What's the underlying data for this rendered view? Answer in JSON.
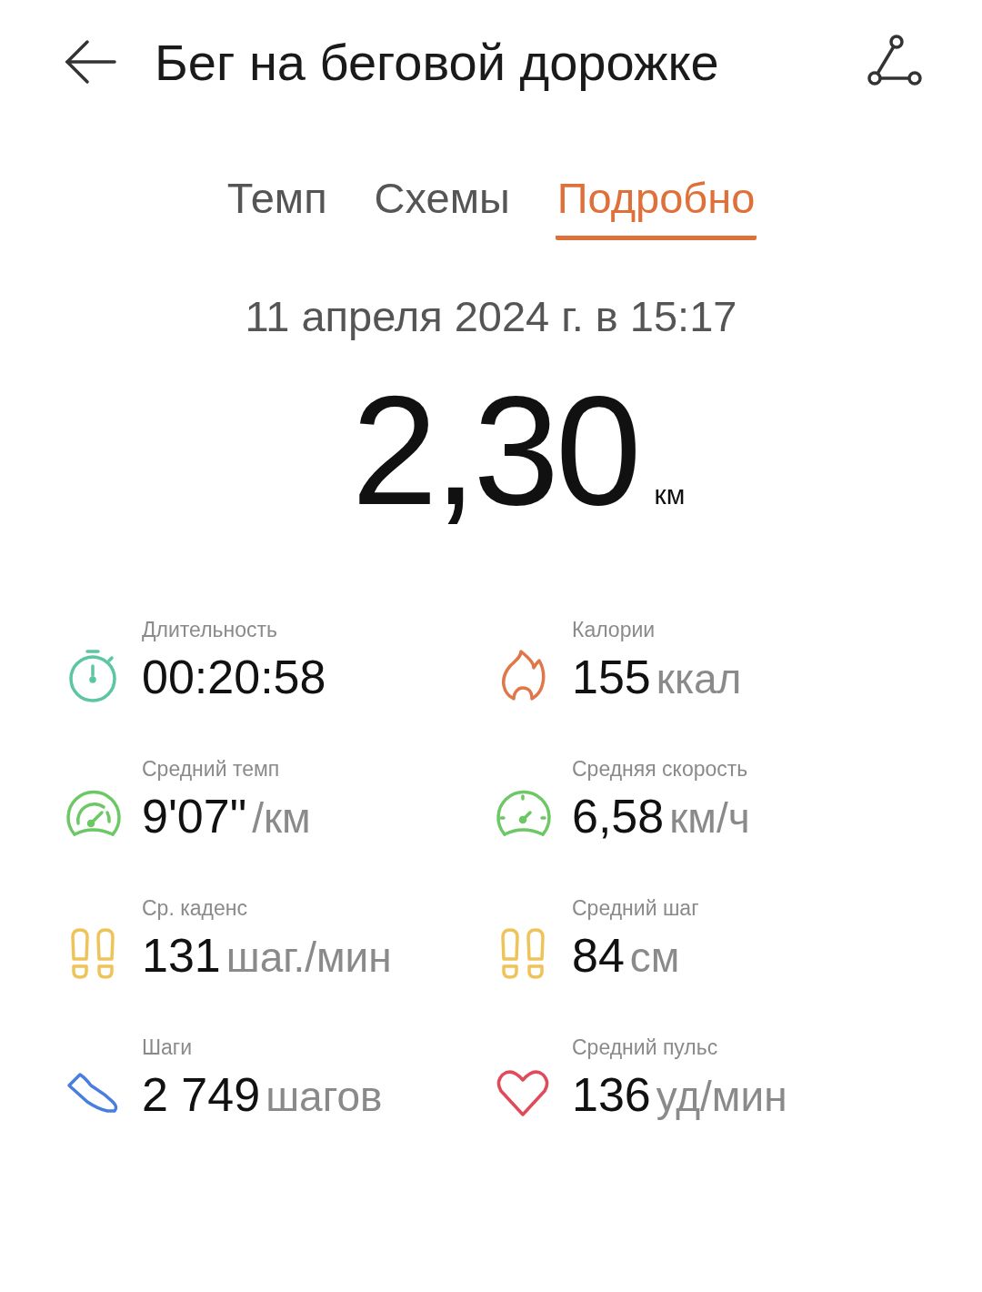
{
  "header": {
    "title": "Бег на беговой дорожке"
  },
  "tabs": [
    {
      "label": "Темп",
      "selected": false
    },
    {
      "label": "Схемы",
      "selected": false
    },
    {
      "label": "Подробно",
      "selected": true
    }
  ],
  "date": "11 апреля 2024 г. в 15:17",
  "distance": {
    "value": "2,30",
    "unit": "км"
  },
  "metrics": [
    {
      "kind": "stopwatch",
      "color": "#5cc6a0",
      "label": "Длительность",
      "value": "00:20:58"
    },
    {
      "kind": "flame",
      "color": "#e0774a",
      "label": "Калории",
      "value": "155",
      "unit": "ккал"
    },
    {
      "kind": "pace",
      "color": "#6cc865",
      "label": "Средний темп",
      "value": "9'07\"",
      "unit": "/км"
    },
    {
      "kind": "speed",
      "color": "#6cc865",
      "label": "Средняя скорость",
      "value": "6,58",
      "unit": "км/ч"
    },
    {
      "kind": "footprints",
      "color": "#eec35a",
      "label": "Ср. каденс",
      "value": "131",
      "unit": "шаг./мин"
    },
    {
      "kind": "footprints",
      "color": "#eec35a",
      "label": "Средний шаг",
      "value": "84",
      "unit": "см"
    },
    {
      "kind": "shoe",
      "color": "#4a7de0",
      "label": "Шаги",
      "value": "2 749",
      "unit": "шагов"
    },
    {
      "kind": "heart",
      "color": "#e04a5a",
      "label": "Средний пульс",
      "value": "136",
      "unit": "уд/мин"
    }
  ]
}
